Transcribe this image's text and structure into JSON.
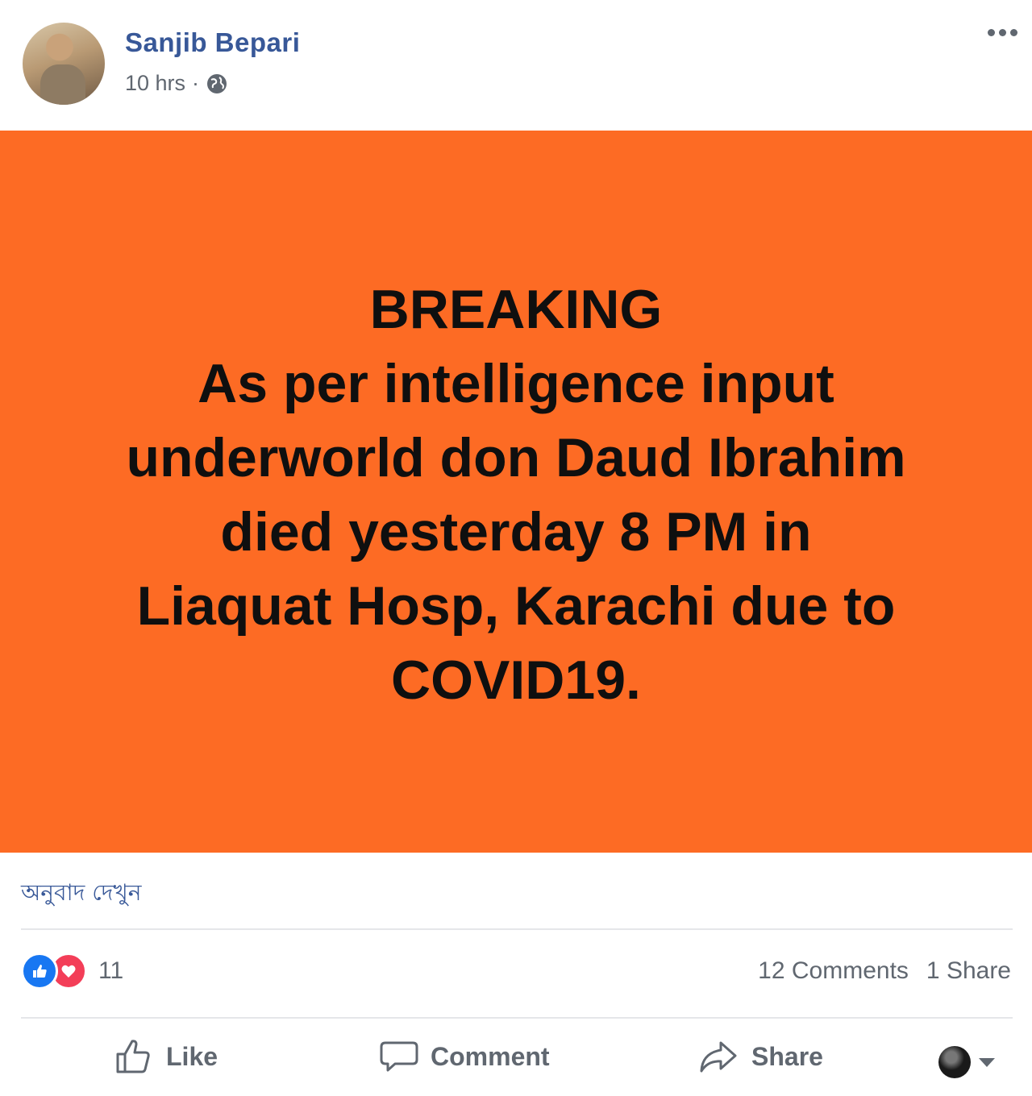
{
  "post": {
    "author": "Sanjib Bepari",
    "time": "10 hrs",
    "separator": "·",
    "audience_icon": "globe-icon",
    "more_icon": "more-options-icon"
  },
  "banner": {
    "background": "#fd6b24",
    "lines": [
      "BREAKING",
      "As per intelligence input",
      "underworld don Daud Ibrahim",
      "died yesterday 8 PM in",
      "Liaquat Hosp, Karachi due to",
      "COVID19."
    ]
  },
  "translate_link": "অনুবাদ দেখুন",
  "stats": {
    "reaction_count": "11",
    "comments": "12 Comments",
    "shares": "1 Share",
    "reaction_icons": [
      "like-icon",
      "love-icon"
    ]
  },
  "actions": {
    "like": "Like",
    "comment": "Comment",
    "share": "Share"
  },
  "colors": {
    "link_blue": "#385898",
    "meta_gray": "#606770",
    "like_blue": "#1877f2",
    "love_red": "#f33e58"
  }
}
